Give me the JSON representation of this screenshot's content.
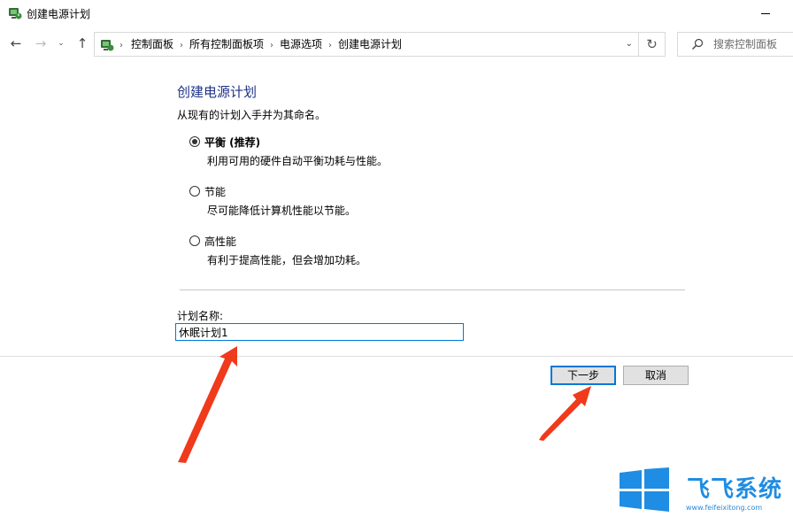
{
  "window": {
    "title": "创建电源计划"
  },
  "nav": {
    "back": "←",
    "forward": "→",
    "recent": "⌄",
    "up": "↑",
    "dropdown": "⌄",
    "refresh": "↻"
  },
  "breadcrumb": {
    "items": [
      "控制面板",
      "所有控制面板项",
      "电源选项",
      "创建电源计划"
    ],
    "separator": "›"
  },
  "search": {
    "placeholder": "搜索控制面板"
  },
  "main": {
    "title": "创建电源计划",
    "intro": "从现有的计划入手并为其命名。",
    "options": [
      {
        "label": "平衡 (推荐)",
        "description": "利用可用的硬件自动平衡功耗与性能。",
        "selected": true
      },
      {
        "label": "节能",
        "description": "尽可能降低计算机性能以节能。",
        "selected": false
      },
      {
        "label": "高性能",
        "description": "有利于提高性能，但会增加功耗。",
        "selected": false
      }
    ],
    "plan_name_label": "计划名称:",
    "plan_name_value": "休眠计划1"
  },
  "buttons": {
    "next": "下一步",
    "cancel": "取消"
  },
  "watermark": {
    "brand": "飞飞系统",
    "url": "www.feifeixitong.com"
  },
  "colors": {
    "accent": "#0078d7",
    "title": "#1e3287",
    "arrow": "#f03a1c",
    "watermark": "#1f8de3"
  },
  "icons": {
    "app": "power-options-icon",
    "search": "search-icon"
  }
}
